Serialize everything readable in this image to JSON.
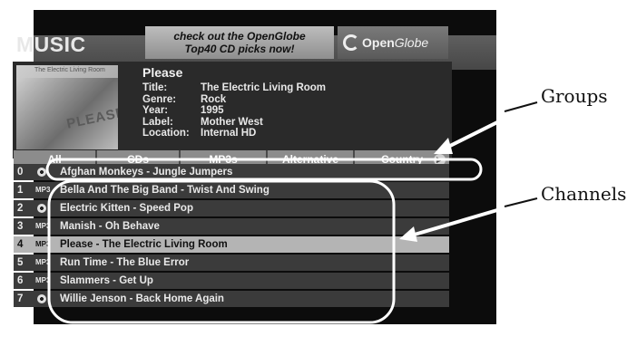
{
  "app": {
    "title": "MUSIC"
  },
  "promo": {
    "line1": "check out the OpenGlobe",
    "line2": "Top40 CD picks now!",
    "logo_open": "Open",
    "logo_globe": "Globe"
  },
  "now_playing": {
    "track": "Please",
    "album_art_text": "PLEASE",
    "album_art_small": "The Electric Living Room",
    "fields": [
      {
        "key": "Title:",
        "value": "The Electric Living Room"
      },
      {
        "key": "Genre:",
        "value": "Rock"
      },
      {
        "key": "Year:",
        "value": "1995"
      },
      {
        "key": "Label:",
        "value": "Mother West"
      },
      {
        "key": "Location:",
        "value": "Internal HD"
      }
    ]
  },
  "tabs": [
    {
      "label": "All",
      "active": true
    },
    {
      "label": "CDs",
      "active": false
    },
    {
      "label": "MP3s",
      "active": false
    },
    {
      "label": "Alternative",
      "active": false
    },
    {
      "label": "Country",
      "active": false
    }
  ],
  "list": [
    {
      "num": "0",
      "type": "cd",
      "title": "Afghan Monkeys - Jungle Jumpers"
    },
    {
      "num": "1",
      "type": "MP3",
      "title": "Bella And The Big Band - Twist And Swing"
    },
    {
      "num": "2",
      "type": "cd",
      "title": "Electric Kitten - Speed Pop"
    },
    {
      "num": "3",
      "type": "MP3",
      "title": "Manish - Oh Behave"
    },
    {
      "num": "4",
      "type": "MP3",
      "title": "Please - The Electric Living Room",
      "selected": true
    },
    {
      "num": "5",
      "type": "MP3",
      "title": "Run Time - The Blue Error"
    },
    {
      "num": "6",
      "type": "MP3",
      "title": "Slammers - Get Up"
    },
    {
      "num": "7",
      "type": "cd",
      "title": "Willie Jenson - Back Home Again"
    }
  ],
  "callouts": {
    "groups": "Groups",
    "channels": "Channels"
  },
  "colors": {
    "screen_bg": "#0c0c0c",
    "tab_bar": "#8c8c8c",
    "selected_row": "#b4b4b4",
    "row_bg": "#3b3b3b"
  }
}
